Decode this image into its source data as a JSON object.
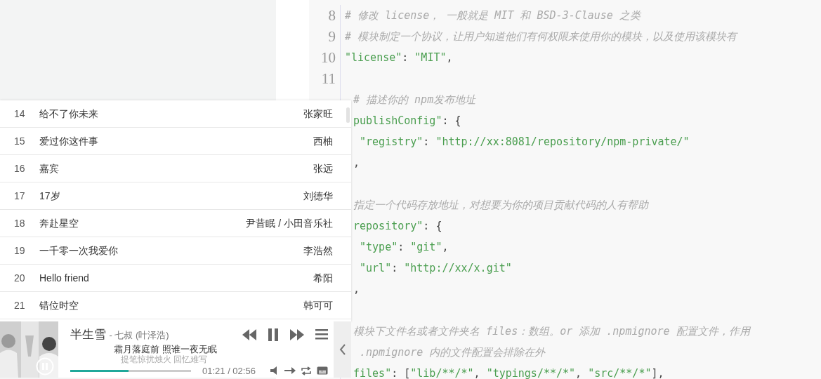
{
  "editor": {
    "lines": [
      {
        "number": "8",
        "kind": "comment",
        "text": "# 修改 license， 一般就是 MIT 和 BSD-3-Clause 之类"
      },
      {
        "number": "9",
        "kind": "comment",
        "text": "# 模块制定一个协议，让用户知道他们有何权限来使用你的模块，以及使用该模块有"
      },
      {
        "number": "10",
        "kind": "code",
        "tokens": [
          {
            "text": "\"license\"",
            "kind": "string"
          },
          {
            "text": ": ",
            "kind": "punct"
          },
          {
            "text": "\"MIT\"",
            "kind": "string"
          },
          {
            "text": ",",
            "kind": "punct"
          }
        ]
      },
      {
        "number": "11",
        "kind": "blank"
      },
      {
        "kind": "comment",
        "text": "# 描述你的 npm发布地址"
      },
      {
        "kind": "code",
        "tokens": [
          {
            "text": "publishConfig\"",
            "kind": "string"
          },
          {
            "text": ": {",
            "kind": "punct"
          }
        ]
      },
      {
        "kind": "code",
        "tokens": [
          {
            "text": " \"registry\"",
            "kind": "string"
          },
          {
            "text": ": ",
            "kind": "punct"
          },
          {
            "text": "\"http://xx:8081/repository/npm-private/\"",
            "kind": "string"
          }
        ]
      },
      {
        "kind": "code",
        "tokens": [
          {
            "text": ",",
            "kind": "punct"
          }
        ]
      },
      {
        "kind": "blank"
      },
      {
        "kind": "comment",
        "text": "指定一个代码存放地址，对想要为你的项目贡献代码的人有帮助"
      },
      {
        "kind": "code",
        "tokens": [
          {
            "text": "repository\"",
            "kind": "string"
          },
          {
            "text": ": {",
            "kind": "punct"
          }
        ]
      },
      {
        "kind": "code",
        "tokens": [
          {
            "text": " \"type\"",
            "kind": "string"
          },
          {
            "text": ": ",
            "kind": "punct"
          },
          {
            "text": "\"git\"",
            "kind": "string"
          },
          {
            "text": ",",
            "kind": "punct"
          }
        ]
      },
      {
        "kind": "code",
        "tokens": [
          {
            "text": " \"url\"",
            "kind": "string"
          },
          {
            "text": ": ",
            "kind": "punct"
          },
          {
            "text": "\"http://xx/x.git\"",
            "kind": "string"
          }
        ]
      },
      {
        "kind": "code",
        "tokens": [
          {
            "text": ",",
            "kind": "punct"
          }
        ]
      },
      {
        "kind": "blank"
      },
      {
        "kind": "comment",
        "text": "模块下文件名或者文件夹名 files：数组。or 添加 .npmignore 配置文件，作用"
      },
      {
        "kind": "comment",
        "text": " .npmignore 内的文件配置会排除在外"
      },
      {
        "kind": "code",
        "tokens": [
          {
            "text": "files\"",
            "kind": "string"
          },
          {
            "text": ": [",
            "kind": "punct"
          },
          {
            "text": "\"lib/**/*\"",
            "kind": "string"
          },
          {
            "text": ", ",
            "kind": "punct"
          },
          {
            "text": "\"typings/**/*\"",
            "kind": "string"
          },
          {
            "text": ", ",
            "kind": "punct"
          },
          {
            "text": "\"src/**/*\"",
            "kind": "string"
          },
          {
            "text": "],",
            "kind": "punct"
          }
        ]
      }
    ]
  },
  "playlist": {
    "rows": [
      {
        "index": "14",
        "title": "给不了你未来",
        "artist": "张家旺"
      },
      {
        "index": "15",
        "title": "爱过你这件事",
        "artist": "西柚"
      },
      {
        "index": "16",
        "title": "嘉宾",
        "artist": "张远"
      },
      {
        "index": "17",
        "title": "17岁",
        "artist": "刘德华"
      },
      {
        "index": "18",
        "title": "奔赴星空",
        "artist": "尹昔眠 / 小田音乐社"
      },
      {
        "index": "19",
        "title": "一千零一次我爱你",
        "artist": "李浩然"
      },
      {
        "index": "20",
        "title": "Hello friend",
        "artist": "希阳"
      },
      {
        "index": "21",
        "title": "错位时空",
        "artist": "韩可可"
      }
    ]
  },
  "player": {
    "title": "半生雪",
    "artist": "- 七叔 (叶泽浩)",
    "playing": true,
    "lyrics": [
      {
        "text": "霜月落庭前 照谁一夜无眠",
        "current": true
      },
      {
        "text": "提笔惊扰烛火 回忆难写",
        "current": false
      }
    ],
    "progress": {
      "level": 0.48
    },
    "time": "01:21 / 02:56"
  }
}
